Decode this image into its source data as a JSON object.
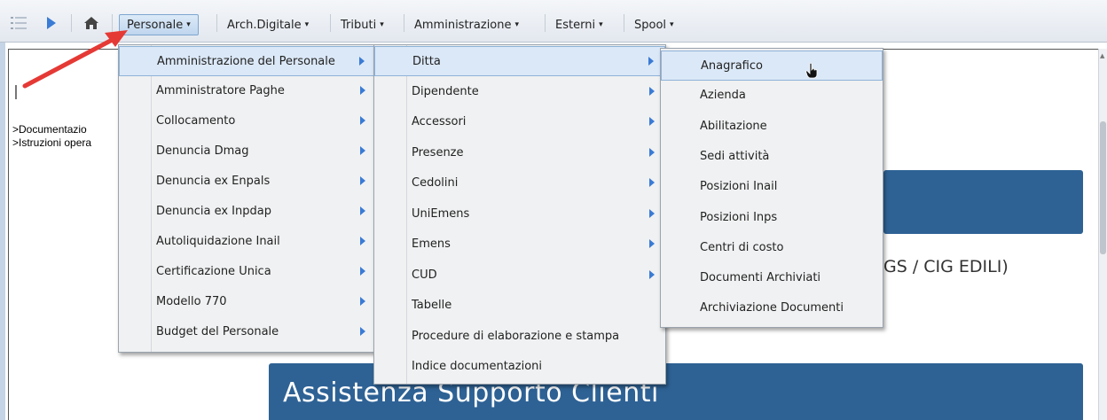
{
  "toolbar": {
    "personale": "Personale",
    "arch_digitale": "Arch.Digitale",
    "tributi": "Tributi",
    "amministrazione": "Amministrazione",
    "esterni": "Esterni",
    "spool": "Spool",
    "caret": "▾"
  },
  "icons": {
    "list": "list-icon",
    "play": "play-icon",
    "home": "home-icon",
    "accent": "#3a7bd5",
    "arrow_color": "#e53935"
  },
  "page": {
    "link_1": ">Documentazio",
    "link_2": ">Istruzioni opera",
    "cig_text": "GS / CIG EDILI)",
    "assist_title": "Assistenza Supporto Clienti",
    "banner_color": "#2e6295"
  },
  "menu1": [
    {
      "label": "Amministrazione del Personale",
      "sub": true
    },
    {
      "label": "Amministratore Paghe",
      "sub": true
    },
    {
      "label": "Collocamento",
      "sub": true
    },
    {
      "label": "Denuncia Dmag",
      "sub": true
    },
    {
      "label": "Denuncia ex Enpals",
      "sub": true
    },
    {
      "label": "Denuncia ex Inpdap",
      "sub": true
    },
    {
      "label": "Autoliquidazione Inail",
      "sub": true
    },
    {
      "label": "Certificazione Unica",
      "sub": true
    },
    {
      "label": "Modello 770",
      "sub": true
    },
    {
      "label": "Budget del Personale",
      "sub": true
    }
  ],
  "menu2": [
    {
      "label": "Ditta",
      "sub": true
    },
    {
      "label": "Dipendente",
      "sub": true
    },
    {
      "label": "Accessori",
      "sub": true
    },
    {
      "label": "Presenze",
      "sub": true
    },
    {
      "label": "Cedolini",
      "sub": true
    },
    {
      "label": "UniEmens",
      "sub": true
    },
    {
      "label": "Emens",
      "sub": true
    },
    {
      "label": "CUD",
      "sub": true
    },
    {
      "label": "Tabelle",
      "sub": false
    },
    {
      "label": "Procedure di elaborazione e stampa",
      "sub": false
    },
    {
      "label": "Indice documentazioni",
      "sub": false
    }
  ],
  "menu3": [
    {
      "label": "Anagrafico"
    },
    {
      "label": "Azienda"
    },
    {
      "label": "Abilitazione"
    },
    {
      "label": "Sedi attività"
    },
    {
      "label": "Posizioni Inail"
    },
    {
      "label": "Posizioni Inps"
    },
    {
      "label": "Centri di costo"
    },
    {
      "label": "Documenti Archiviati"
    },
    {
      "label": "Archiviazione Documenti"
    }
  ]
}
